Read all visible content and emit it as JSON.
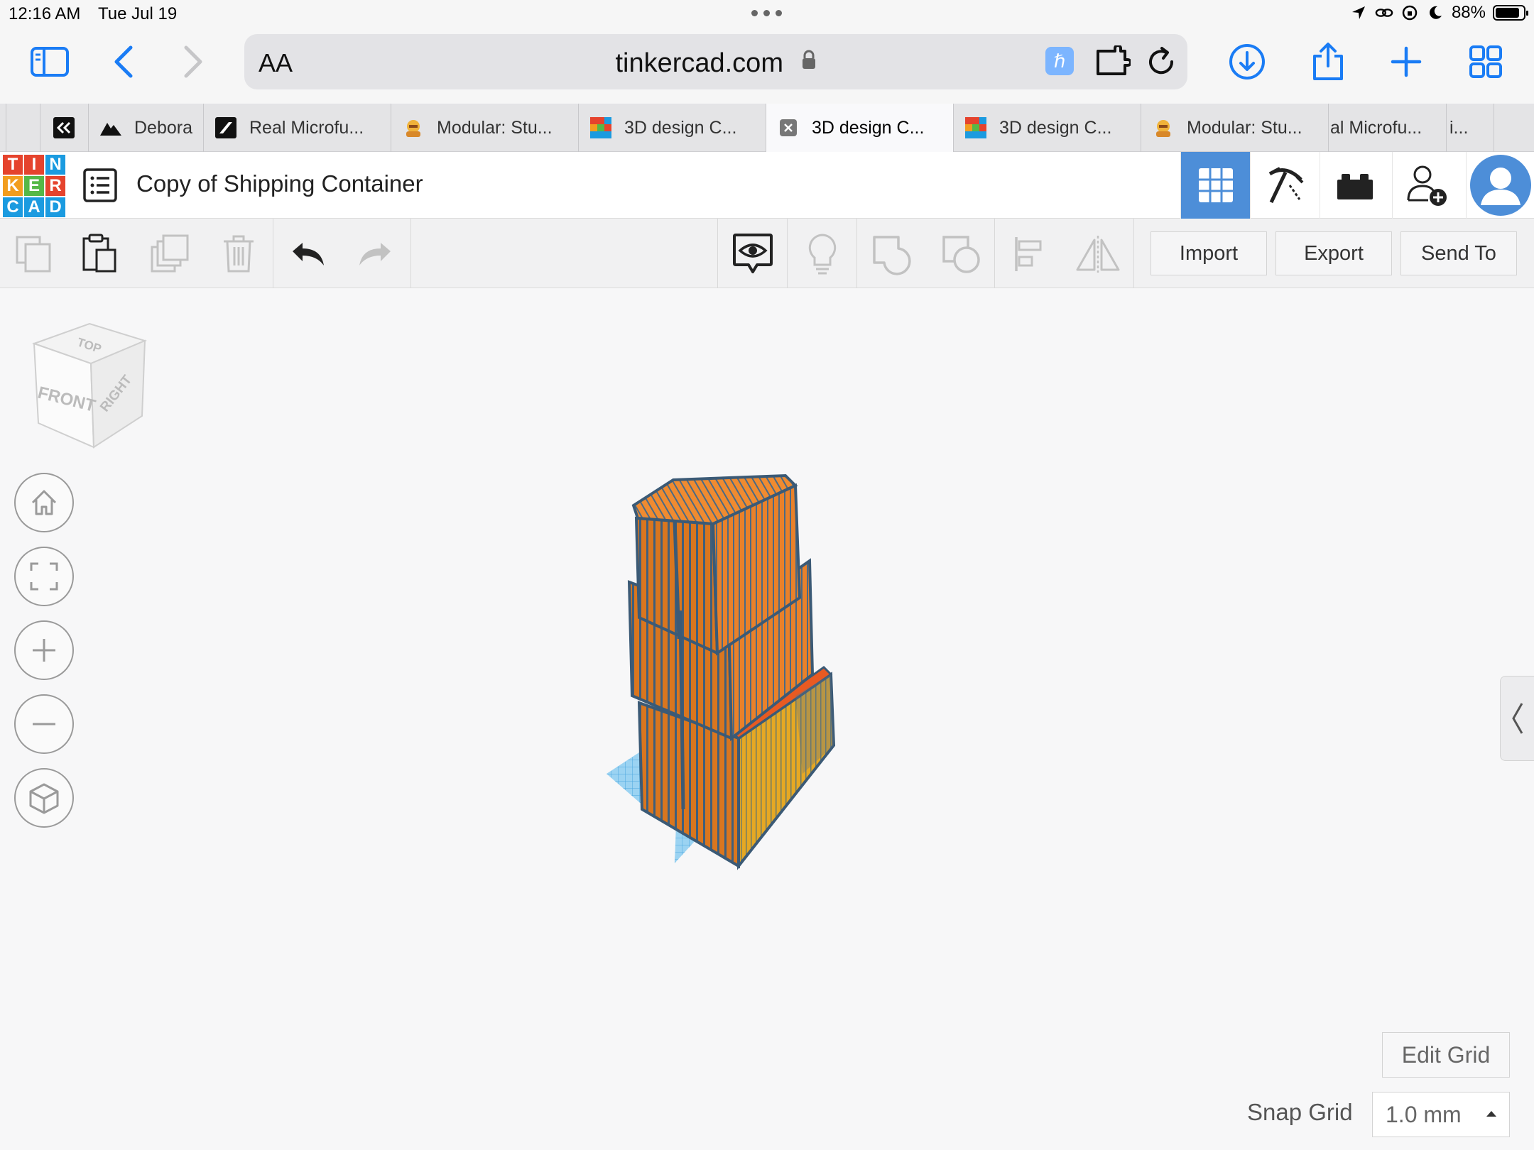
{
  "status_bar": {
    "time": "12:16 AM",
    "date": "Tue Jul 19",
    "battery": "88%",
    "battery_level": 0.88
  },
  "browser": {
    "text_size_label": "AA",
    "url": "tinkercad.com",
    "accent_color": "#1a7cf5"
  },
  "tabs": [
    {
      "label": "Debora",
      "icon": "mountain-icon"
    },
    {
      "label": "Real Microfu...",
      "icon": "slash-logo-icon"
    },
    {
      "label": "Modular: Stu...",
      "icon": "character-icon"
    },
    {
      "label": "3D design C...",
      "icon": "tinkercad-icon"
    },
    {
      "label": "3D design C...",
      "icon": "close-icon",
      "active": true
    },
    {
      "label": "3D design C...",
      "icon": "tinkercad-icon"
    },
    {
      "label": "Modular: Stu...",
      "icon": "character-icon"
    },
    {
      "label": "al Microfu...",
      "icon": ""
    },
    {
      "label": "i...",
      "icon": ""
    }
  ],
  "tinkercad": {
    "logo_letters": [
      "T",
      "I",
      "N",
      "K",
      "E",
      "R",
      "C",
      "A",
      "D"
    ],
    "logo_colors": [
      "#e5432d",
      "#e5432d",
      "#1b9be0",
      "#f29d1f",
      "#55b847",
      "#e5432d",
      "#1b9be0",
      "#1b9be0",
      "#1b9be0"
    ],
    "design_title": "Copy of Shipping Container",
    "active_view_color": "#4d8ed8"
  },
  "toolbar": {
    "import_label": "Import",
    "export_label": "Export",
    "send_to_label": "Send To"
  },
  "viewcube": {
    "top": "TOP",
    "front": "FRONT",
    "right": "RIGHT"
  },
  "workplane": {
    "edit_grid_label": "Edit Grid",
    "snap_grid_label": "Snap Grid",
    "snap_grid_value": "1.0 mm"
  }
}
